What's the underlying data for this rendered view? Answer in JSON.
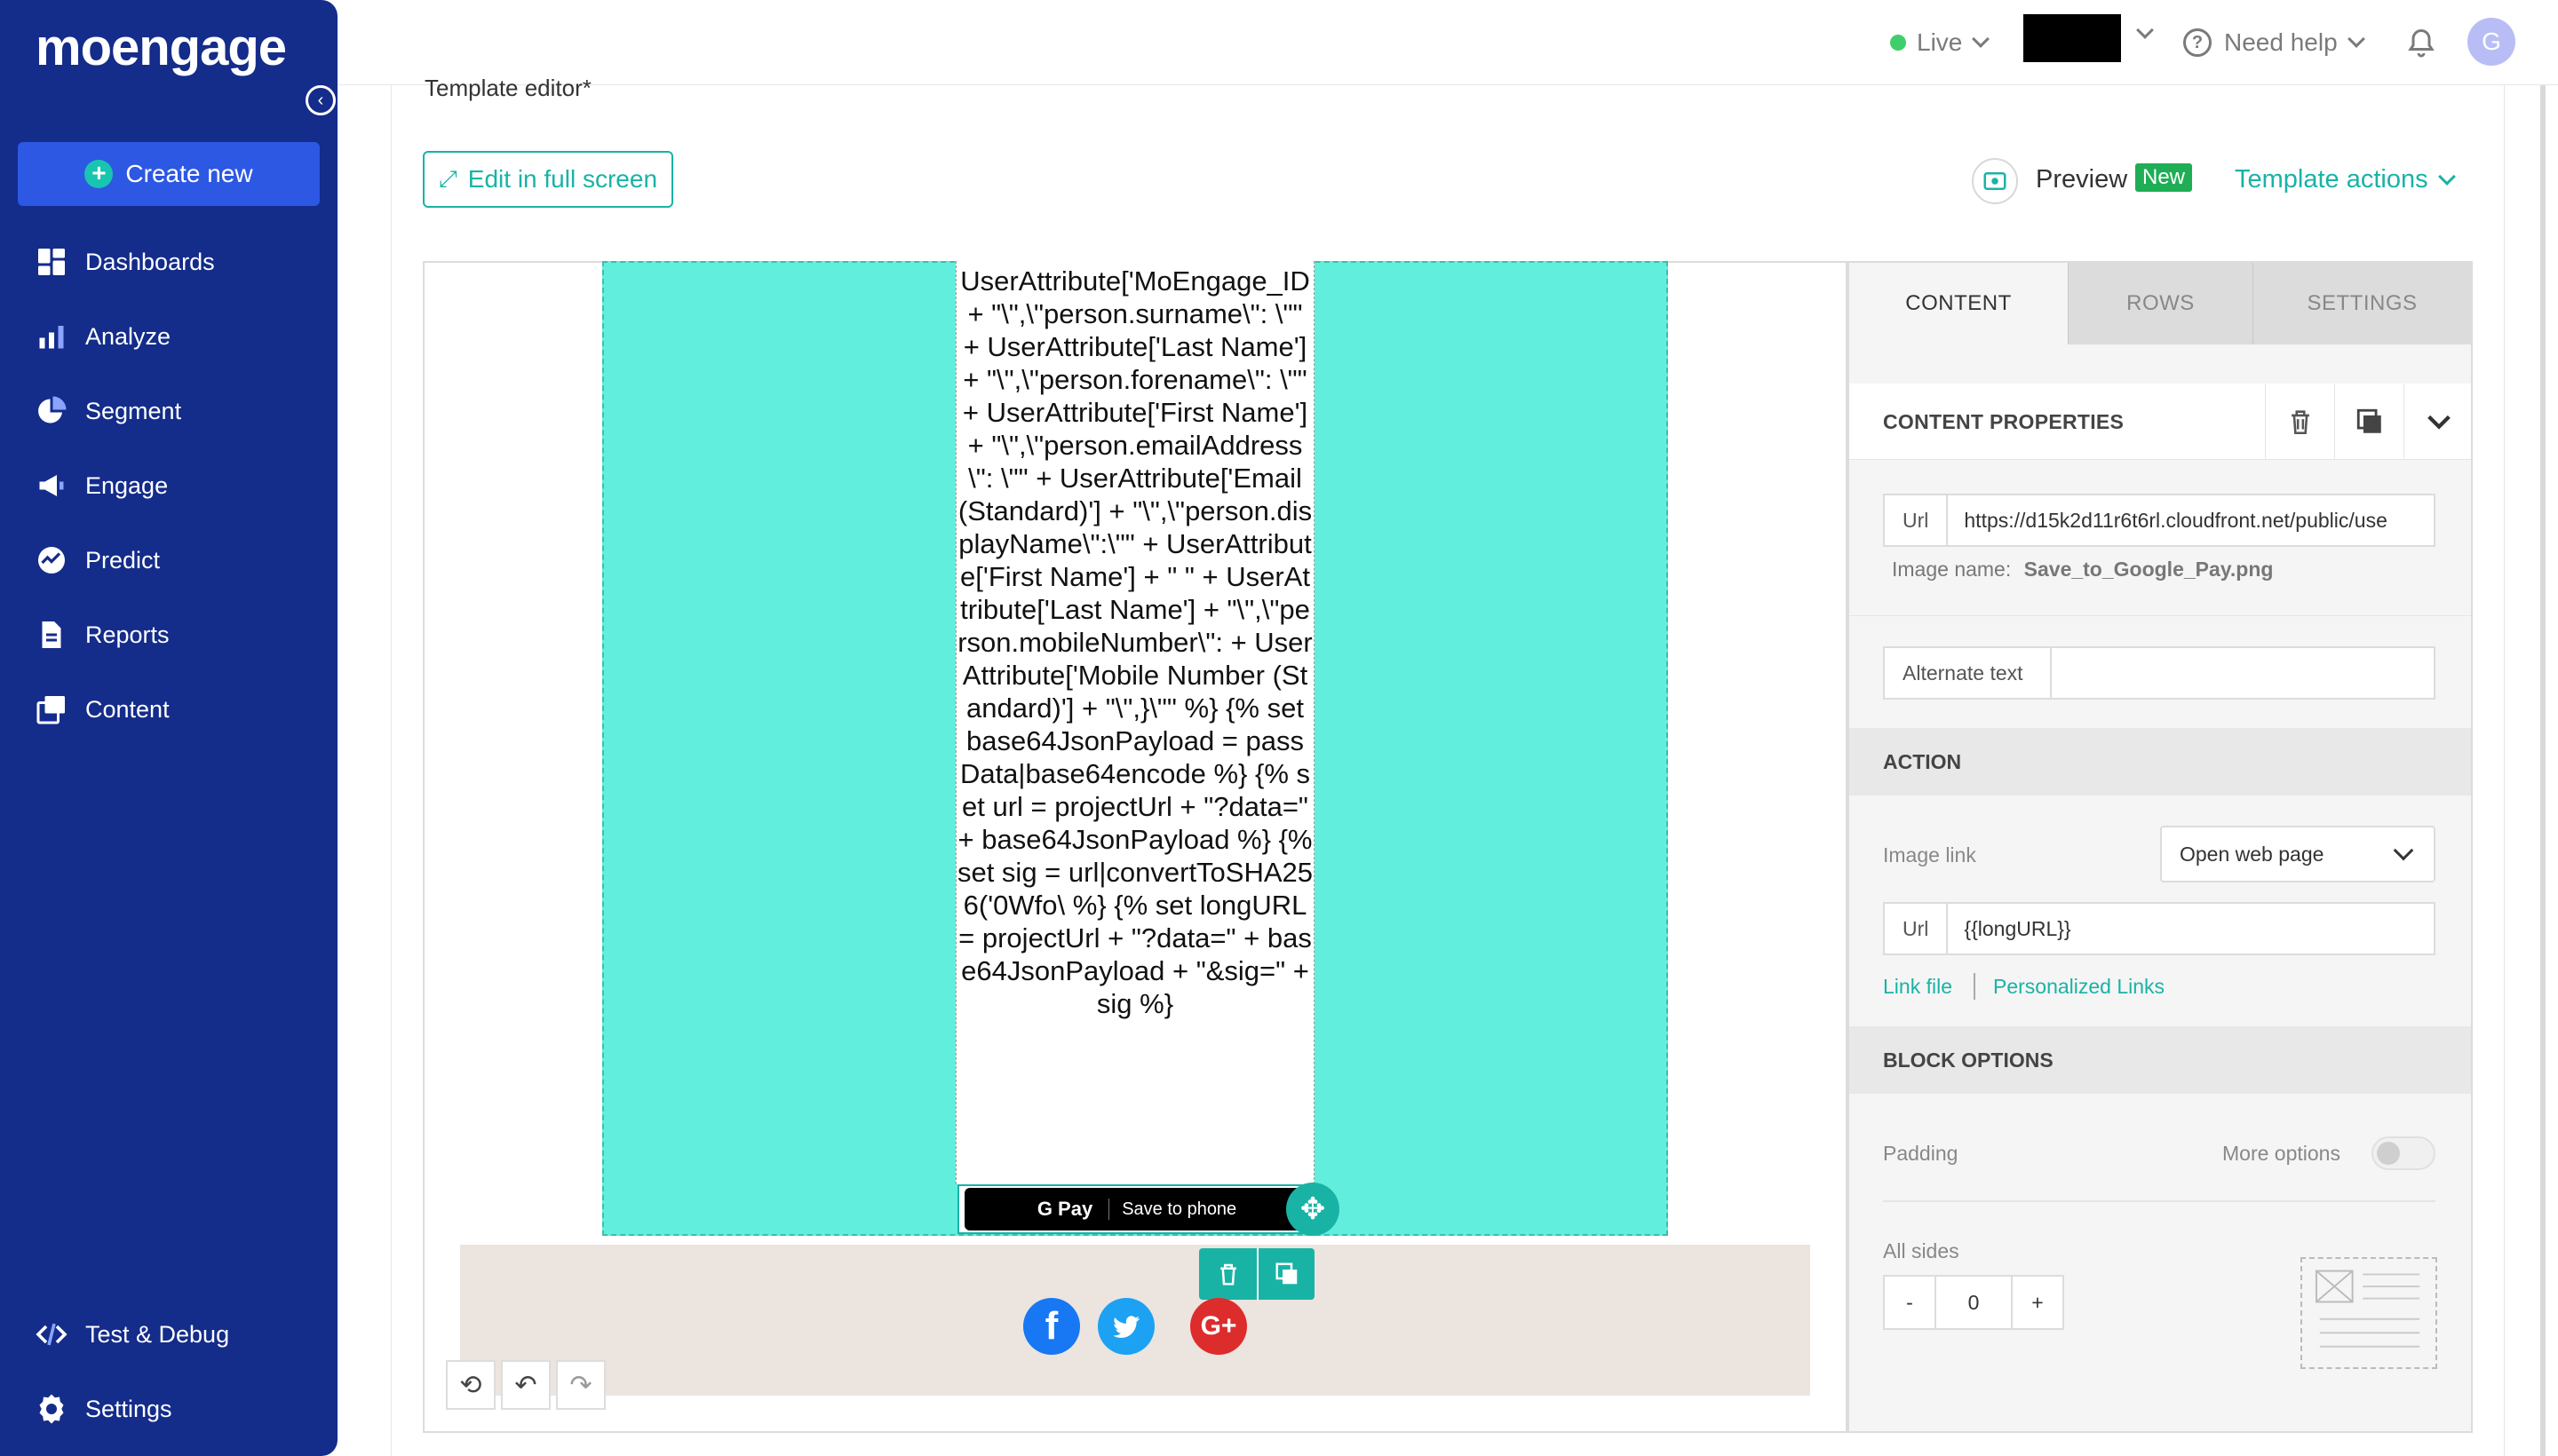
{
  "app": {
    "logo": "moengage"
  },
  "sidebar": {
    "create_new": "Create new",
    "items": [
      {
        "label": "Dashboards",
        "icon": "dashboard-icon"
      },
      {
        "label": "Analyze",
        "icon": "bar-chart-icon"
      },
      {
        "label": "Segment",
        "icon": "pie-chart-icon"
      },
      {
        "label": "Engage",
        "icon": "megaphone-icon"
      },
      {
        "label": "Predict",
        "icon": "trend-icon"
      },
      {
        "label": "Reports",
        "icon": "document-icon"
      },
      {
        "label": "Content",
        "icon": "content-stack-icon"
      }
    ],
    "bottom": [
      {
        "label": "Test & Debug",
        "icon": "code-icon"
      },
      {
        "label": "Settings",
        "icon": "gear-icon"
      }
    ]
  },
  "topbar": {
    "env": "Live",
    "help": "Need help",
    "avatar": "G"
  },
  "editor": {
    "title": "Template editor*",
    "edit_full_screen": "Edit in full screen",
    "preview": "Preview",
    "new_badge": "New",
    "template_actions": "Template actions"
  },
  "canvas": {
    "code_text": "UserAttribute['MoEngage_ID + \"\\\",\\\"person.surname\\\": \\\"\" + UserAttribute['Last Name'] + \"\\\",\\\"person.forename\\\": \\\"\" + UserAttribute['First Name'] + \"\\\",\\\"person.emailAddress\\\": \\\"\" + UserAttribute['Email (Standard)'] + \"\\\",\\\"person.displayName\\\":\\\"\" + UserAttribute['First Name'] + \" \" + UserAttribute['Last Name'] + \"\\\",\\\"person.mobileNumber\\\": + UserAttribute['Mobile Number (Standard)'] + \"\\\",}\\\"\" %} {% set base64JsonPayload = passData|base64encode %} {% set url = projectUrl + \"?data=\" + base64JsonPayload %} {% set sig = url|convertToSHA256('0Wfo\\ %} {% set longURL = projectUrl + \"?data=\" + base64JsonPayload + \"&sig=\" + sig %}",
    "gpay_brand": "G Pay",
    "gpay_label": "Save to phone"
  },
  "panel": {
    "tabs": [
      "CONTENT",
      "ROWS",
      "SETTINGS"
    ],
    "props_title": "CONTENT PROPERTIES",
    "image_url_label": "Url",
    "image_url_value": "https://d15k2d11r6t6rl.cloudfront.net/public/use",
    "image_name_label": "Image name:",
    "image_name_value": "Save_to_Google_Pay.png",
    "alt_text_label": "Alternate text",
    "alt_text_value": "",
    "action_head": "ACTION",
    "image_link_label": "Image link",
    "image_link_value": "Open web page",
    "link_url_label": "Url",
    "link_url_value": "{{longURL}}",
    "link_file": "Link file",
    "personalized_links": "Personalized Links",
    "block_head": "BLOCK OPTIONS",
    "padding_label": "Padding",
    "more_options": "More options",
    "all_sides": "All sides",
    "padding_minus": "-",
    "padding_value": "0",
    "padding_plus": "+"
  },
  "colors": {
    "sidebar": "#142c8a",
    "accent": "#19b3a6",
    "row_bg": "#62eedc",
    "create_btn": "#2d58e3"
  }
}
